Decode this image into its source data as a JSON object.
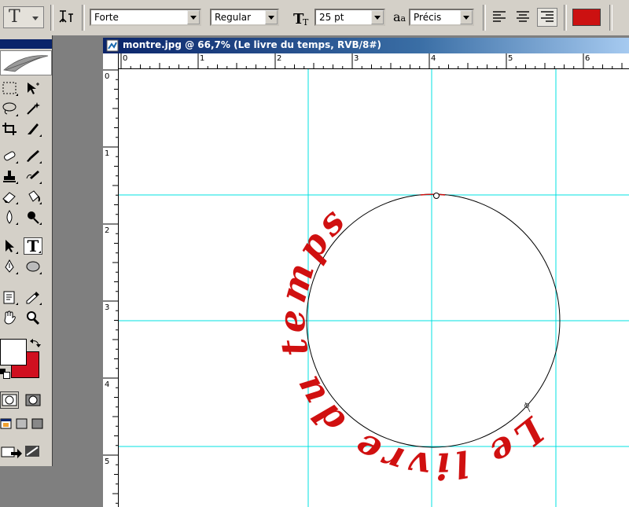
{
  "options_bar": {
    "tool_icon_glyph": "T",
    "orientation_icon": "text-orientation-icon",
    "font_family": "Forte",
    "font_style": "Regular",
    "font_size": "25 pt",
    "antialias_label": "a",
    "antialias_sub": "a",
    "antialias_value": "Précis",
    "text_color": "#cc1111",
    "align_buttons": [
      "align-left-icon",
      "align-center-icon",
      "align-right-icon"
    ]
  },
  "document": {
    "title": "montre.jpg @ 66,7% (Le livre du temps, RVB/8#)",
    "path_text": "Le livre du temps",
    "text_color": "#d01010",
    "guide_color": "#00e0e0",
    "ruler_top_labels": [
      "0",
      "1",
      "2",
      "3",
      "4",
      "5",
      "6"
    ],
    "ruler_left_labels": [
      "0",
      "1",
      "2",
      "3",
      "4",
      "5"
    ]
  },
  "toolbox": {
    "foreground_color": "#ffffff",
    "background_color": "#d01020",
    "type_tool_glyph": "T"
  }
}
